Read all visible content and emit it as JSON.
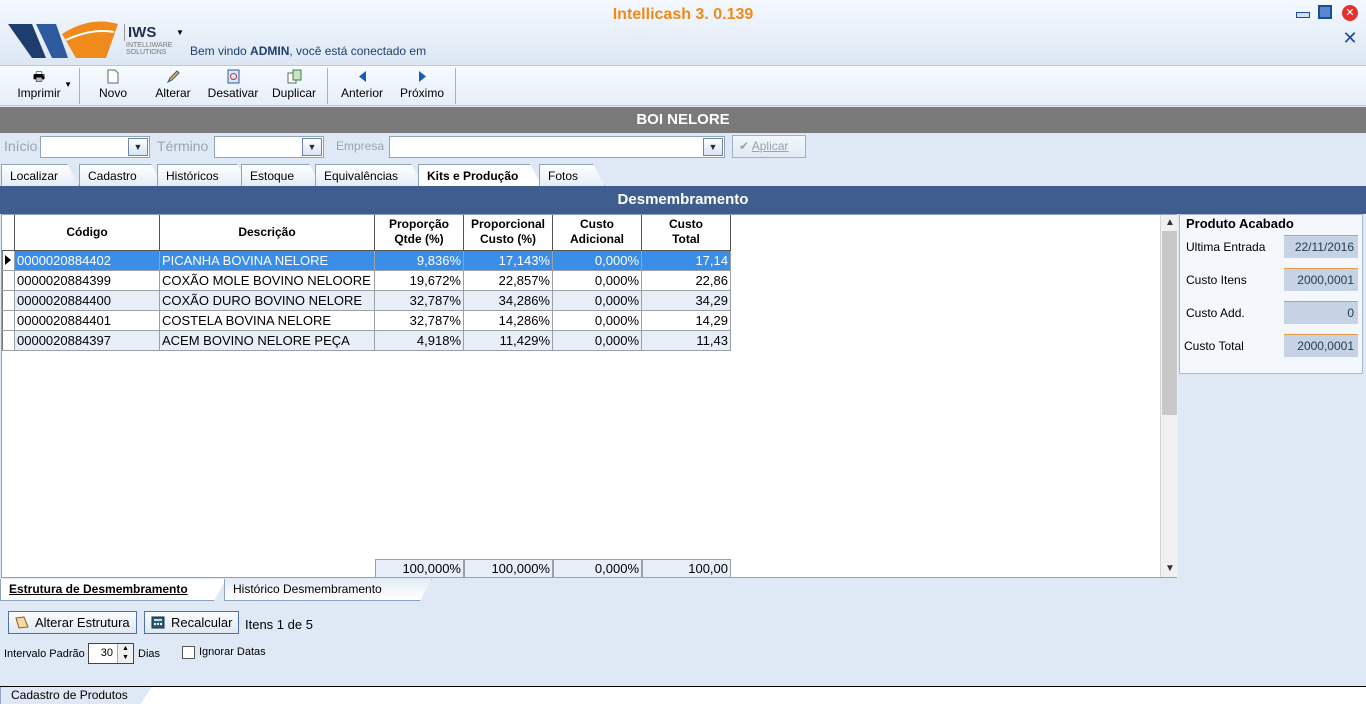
{
  "app": {
    "title": "Intellicash 3. 0.139",
    "logo_text": "IWS",
    "logo_sub": "INTELLIWARE SOLUTIONS",
    "welcome_prefix": "Bem vindo ",
    "user": "ADMIN",
    "welcome_suffix": ", você está conectado em"
  },
  "toolbar": {
    "print": "Imprimir",
    "new": "Novo",
    "edit": "Alterar",
    "deactivate": "Desativar",
    "duplicate": "Duplicar",
    "previous": "Anterior",
    "next": "Próximo"
  },
  "record_title": "BOI NELORE",
  "filters": {
    "start_label": "Início",
    "end_label": "Término",
    "company_label": "Empresa",
    "apply": "Aplicar"
  },
  "tabs": [
    "Localizar",
    "Cadastro",
    "Históricos",
    "Estoque",
    "Equivalências",
    "Kits e Produção",
    "Fotos"
  ],
  "active_tab": "Kits e Produção",
  "panel_title": "Desmembramento",
  "grid": {
    "headers": {
      "code": "Código",
      "description": "Descrição",
      "prop_qty_1": "Proporção",
      "prop_qty_2": "Qtde (%)",
      "prop_cost_1": "Proporcional",
      "prop_cost_2": "Custo (%)",
      "add_cost_1": "Custo",
      "add_cost_2": "Adicional",
      "total_cost_1": "Custo",
      "total_cost_2": "Total"
    },
    "rows": [
      {
        "code": "0000020884402",
        "description": "PICANHA BOVINA NELORE",
        "prop_qty": "9,836%",
        "prop_cost": "17,143%",
        "add_cost": "0,000%",
        "total_cost": "17,14"
      },
      {
        "code": "0000020884399",
        "description": "COXÃO MOLE BOVINO NELOORE",
        "prop_qty": "19,672%",
        "prop_cost": "22,857%",
        "add_cost": "0,000%",
        "total_cost": "22,86"
      },
      {
        "code": "0000020884400",
        "description": "COXÃO DURO BOVINO NELORE",
        "prop_qty": "32,787%",
        "prop_cost": "34,286%",
        "add_cost": "0,000%",
        "total_cost": "34,29"
      },
      {
        "code": "0000020884401",
        "description": "COSTELA BOVINA NELORE",
        "prop_qty": "32,787%",
        "prop_cost": "14,286%",
        "add_cost": "0,000%",
        "total_cost": "14,29"
      },
      {
        "code": "0000020884397",
        "description": "ACEM BOVINO NELORE PEÇA",
        "prop_qty": "4,918%",
        "prop_cost": "11,429%",
        "add_cost": "0,000%",
        "total_cost": "11,43"
      }
    ],
    "totals": {
      "prop_qty": "100,000%",
      "prop_cost": "100,000%",
      "add_cost": "0,000%",
      "total_cost": "100,00"
    }
  },
  "finished_product": {
    "title": "Produto Acabado",
    "last_entry_label": "Ultima Entrada",
    "last_entry": "22/11/2016",
    "items_cost_label": "Custo Itens",
    "items_cost": "2000,0001",
    "add_cost_label": "Custo Add.",
    "add_cost": "0",
    "total_cost_label": "Custo Total",
    "total_cost": "2000,0001"
  },
  "bottom_tabs": [
    "Estrutura de Desmembramento",
    "Histórico Desmembramento"
  ],
  "actions": {
    "edit_structure": "Alterar Estrutura",
    "recalculate": "Recalcular",
    "items_count": "Itens 1 de 5",
    "interval_label": "Intervalo Padrão",
    "interval_value": "30",
    "days": "Dias",
    "ignore_dates": "Ignorar Datas"
  },
  "status_tab": "Cadastro de Produtos",
  "colors": {
    "accent": "#3f5e8f",
    "title_orange": "#f08a1a",
    "selection": "#3a8ee8"
  }
}
